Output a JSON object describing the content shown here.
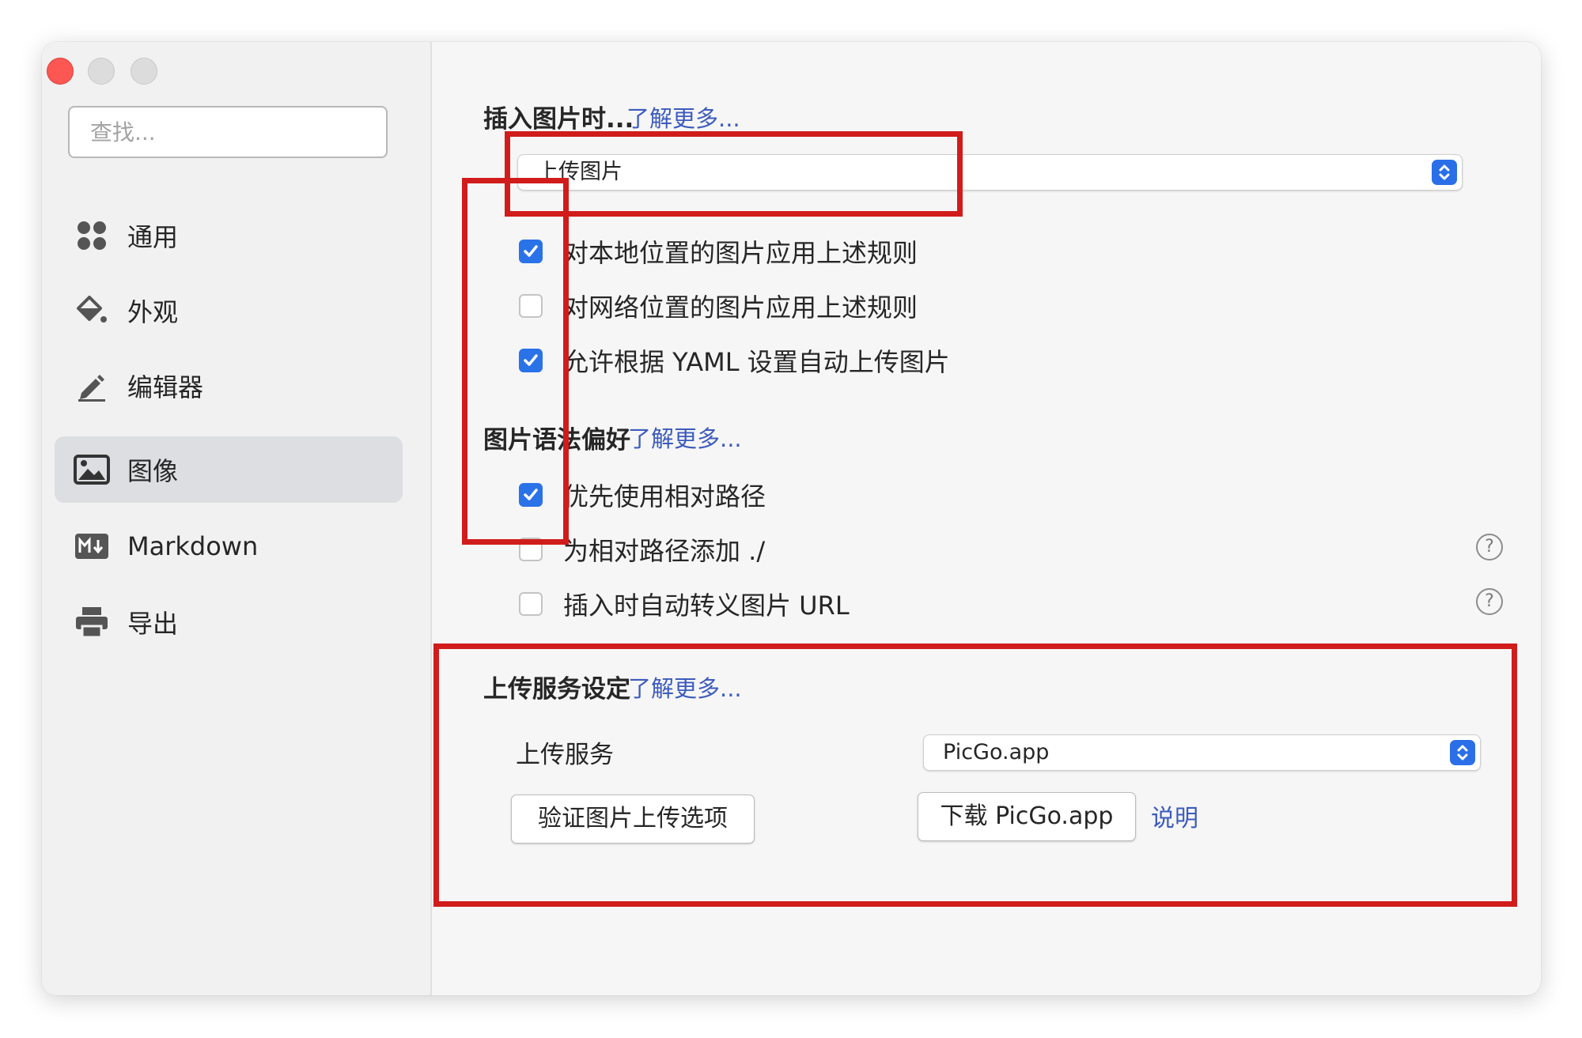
{
  "window": {
    "controls": [
      "close",
      "minimize",
      "zoom"
    ]
  },
  "sidebar": {
    "search_placeholder": "查找...",
    "items": [
      {
        "label": "通用",
        "icon": "grid-icon"
      },
      {
        "label": "外观",
        "icon": "paint-bucket-icon"
      },
      {
        "label": "编辑器",
        "icon": "pencil-icon"
      },
      {
        "label": "图像",
        "icon": "image-icon",
        "active": true
      },
      {
        "label": "Markdown",
        "icon": "markdown-icon"
      },
      {
        "label": "导出",
        "icon": "printer-icon"
      }
    ]
  },
  "insert": {
    "title": "插入图片时...",
    "more": "了解更多...",
    "select_value": "上传图片",
    "options": [
      {
        "label": "对本地位置的图片应用上述规则",
        "checked": true
      },
      {
        "label": "对网络位置的图片应用上述规则",
        "checked": false
      },
      {
        "label": "允许根据 YAML 设置自动上传图片",
        "checked": true
      }
    ]
  },
  "syntax": {
    "title": "图片语法偏好",
    "more": "了解更多...",
    "options": [
      {
        "label": "优先使用相对路径",
        "checked": true
      },
      {
        "label": "为相对路径添加 ./",
        "checked": false,
        "help": "?"
      },
      {
        "label": "插入时自动转义图片 URL",
        "checked": false,
        "help": "?"
      }
    ]
  },
  "upload": {
    "title": "上传服务设定",
    "more": "了解更多...",
    "service_label": "上传服务",
    "service_value": "PicGo.app",
    "verify_button": "验证图片上传选项",
    "download_button": "下载 PicGo.app",
    "explain_link": "说明"
  },
  "colors": {
    "accent": "#2a72e8",
    "link": "#3d5bbd",
    "annotation": "#d11c1c",
    "close": "#fc5753"
  }
}
